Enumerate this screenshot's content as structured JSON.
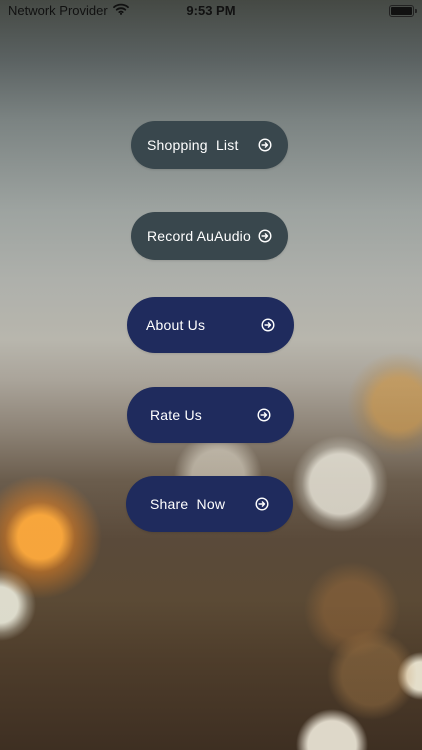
{
  "status_bar": {
    "carrier": "Network Provider",
    "time": "9:53 PM",
    "icons": {
      "wifi": "wifi-icon",
      "battery": "battery-icon"
    }
  },
  "menu": {
    "buttons": [
      {
        "label": "Shopping  List",
        "icon": "arrow-right-circle-icon"
      },
      {
        "label": "Record AuAudio",
        "icon": "arrow-right-circle-icon"
      },
      {
        "label": "About Us",
        "icon": "arrow-right-circle-icon"
      },
      {
        "label": "Rate Us",
        "icon": "arrow-right-circle-icon"
      },
      {
        "label": "Share  Now",
        "icon": "arrow-right-circle-icon"
      }
    ]
  },
  "colors": {
    "button_gray": "#39474d",
    "button_navy": "#1f2b5d",
    "text": "#ffffff"
  }
}
